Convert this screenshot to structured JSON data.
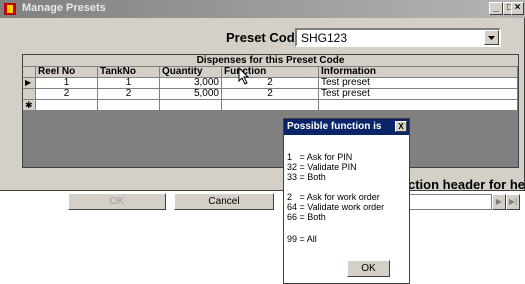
{
  "window": {
    "title": "Manage Presets"
  },
  "preset": {
    "label": "Preset Code",
    "value": "SHG123"
  },
  "grid": {
    "caption": "Dispenses for this Preset Code",
    "columns": [
      "Reel No",
      "TankNo",
      "Quantity",
      "Function",
      "Information"
    ],
    "rows": [
      {
        "indicator": "▶",
        "cells": [
          "1",
          "1",
          "3,000",
          "2",
          "Test preset"
        ]
      },
      {
        "indicator": "",
        "cells": [
          "2",
          "2",
          "5,000",
          "2",
          "Test preset"
        ]
      },
      {
        "indicator": "✱",
        "cells": [
          "",
          "",
          "",
          "",
          ""
        ]
      }
    ]
  },
  "buttons": {
    "ok": "OK",
    "cancel": "Cancel"
  },
  "help_text": "ction header for help",
  "nav": {
    "next": "▶",
    "last": "▶|"
  },
  "popup": {
    "title": "Possible function is",
    "close": "X",
    "lines": [
      "1   = Ask for PIN",
      "32 = Validate PIN",
      "33 = Both",
      "",
      "2   = Ask for work order",
      "64 = Validate work order",
      "66 = Both",
      "",
      "99 = All"
    ],
    "ok": "OK"
  }
}
